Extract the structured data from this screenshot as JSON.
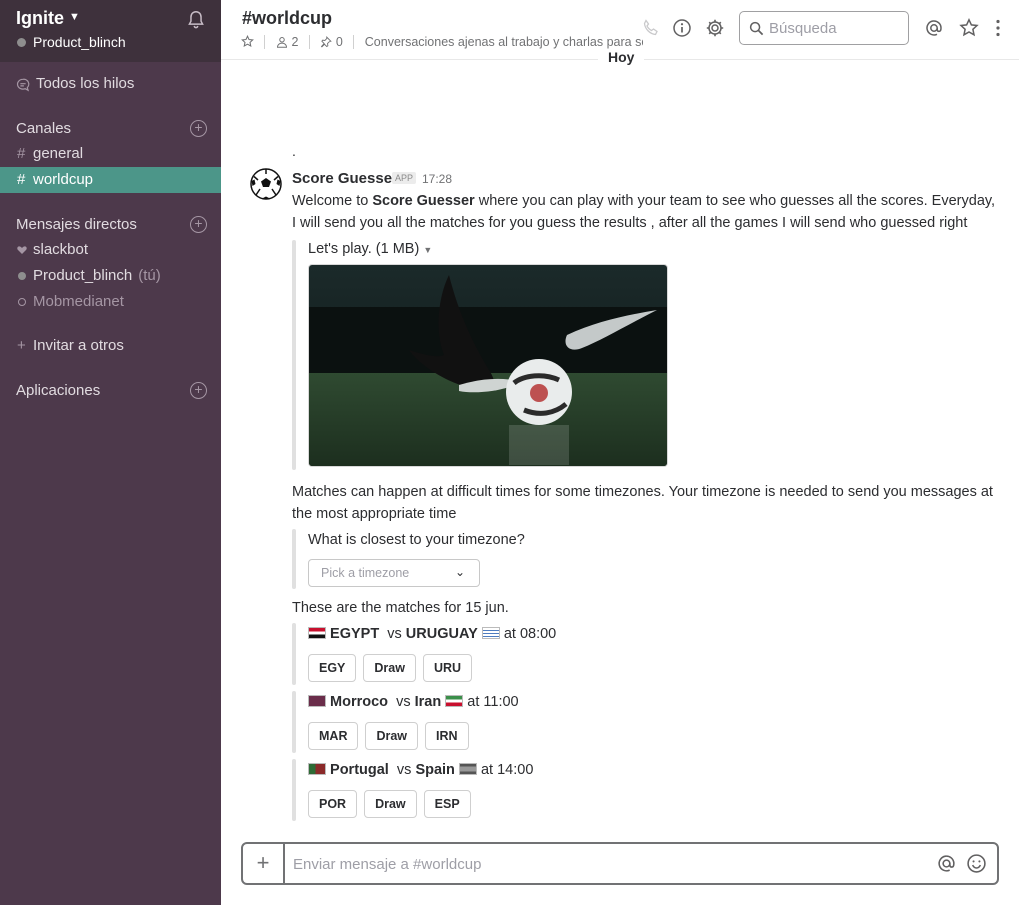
{
  "sidebar": {
    "team_name": "Ignite",
    "current_user": "Product_blinch",
    "all_threads": "Todos los hilos",
    "channels_title": "Canales",
    "channels": [
      {
        "label": "general",
        "active": false
      },
      {
        "label": "worldcup",
        "active": true
      }
    ],
    "dm_title": "Mensajes directos",
    "dms": [
      {
        "label": "slackbot",
        "status": "bot"
      },
      {
        "label": "Product_blinch",
        "suffix": "(tú)",
        "status": "online"
      },
      {
        "label": "Mobmedianet",
        "status": "offline"
      }
    ],
    "invite": "Invitar a otros",
    "apps_title": "Aplicaciones"
  },
  "header": {
    "channel_name": "#worldcup",
    "members_count": "2",
    "pins_count": "0",
    "topic": "Conversaciones ajenas al trabajo y charlas para sc",
    "search_placeholder": "Búsqueda"
  },
  "day_divider": "Hoy",
  "message": {
    "pre_text": ".",
    "sender": "Score Guesser",
    "badge": "APP",
    "time": "17:28",
    "intro_parts": {
      "a": "Welcome to ",
      "b": "Score Guesser",
      "c": " where you can play with your team to see who guesses all the scores. Everyday, I will send you all the matches for you guess the results , after all the games I will send who guessed right"
    },
    "attachment_title": "Let's play. (1 MB)",
    "timezone_text": "Matches can happen at difficult times for some timezones. Your timezone is needed to send you messages at the most appropriate time",
    "timezone_question": "What is closest to your timezone?",
    "timezone_placeholder": "Pick a timezone",
    "matches_intro": "These are the matches for 15 jun.",
    "matches": [
      {
        "home": "EGYPT",
        "vs": "vs",
        "away": "URUGUAY",
        "time": "at 08:00",
        "buttons": [
          "EGY",
          "Draw",
          "URU"
        ]
      },
      {
        "home": "Morroco",
        "vs": "vs",
        "away": "Iran",
        "time": "at 11:00",
        "buttons": [
          "MAR",
          "Draw",
          "IRN"
        ]
      },
      {
        "home": "Portugal",
        "vs": "vs",
        "away": "Spain",
        "time": "at 14:00",
        "buttons": [
          "POR",
          "Draw",
          "ESP"
        ]
      }
    ]
  },
  "composer": {
    "placeholder": "Enviar mensaje a #worldcup"
  },
  "colors": {
    "sidebar_bg": "#4d394b",
    "active_channel": "#4c9689"
  }
}
